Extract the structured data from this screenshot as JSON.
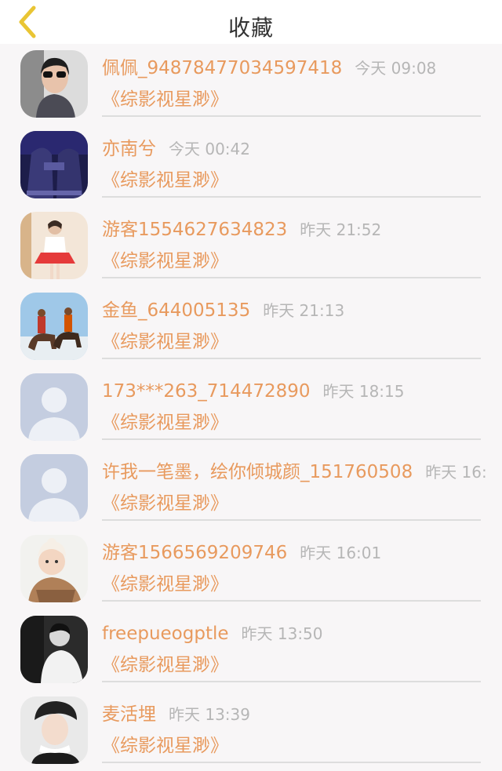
{
  "header": {
    "title": "收藏"
  },
  "items": [
    {
      "name": "佩佩_9487847703459741​8",
      "time": "今天 09:08",
      "subtitle": "《综影视星渺》",
      "avatar": "photo-woman-sunglasses-avatar"
    },
    {
      "name": "亦南兮",
      "time": "今天 00:42",
      "subtitle": "《综影视星渺》",
      "avatar": "photo-dark-outfit-avatar"
    },
    {
      "name": "游客1554627634823",
      "time": "昨天 21:52",
      "subtitle": "《综影视星渺》",
      "avatar": "photo-girl-red-skirt-avatar"
    },
    {
      "name": "金鱼_644005135",
      "time": "昨天 21:13",
      "subtitle": "《综影视星渺》",
      "avatar": "photo-horse-riders-avatar"
    },
    {
      "name": "173***263_714472890",
      "time": "昨天 18:15",
      "subtitle": "《综影视星渺》",
      "avatar": "default-user-avatar"
    },
    {
      "name": "许我一笔墨，绘你倾城颜_151760508",
      "time": "昨天 16:",
      "subtitle": "《综影视星渺》",
      "avatar": "default-user-avatar"
    },
    {
      "name": "游客1566569209746",
      "time": "昨天 16:01",
      "subtitle": "《综影视星渺》",
      "avatar": "photo-baby-avatar"
    },
    {
      "name": "freepueogptle",
      "time": "昨天 13:50",
      "subtitle": "《综影视星渺》",
      "avatar": "photo-bw-man-avatar"
    },
    {
      "name": "麦活埋",
      "time": "昨天 13:39",
      "subtitle": "《综影视星渺》",
      "avatar": "photo-woman-hat-avatar"
    }
  ],
  "colors": {
    "accent": "#e89a5e",
    "back_icon": "#e9c534",
    "time": "#b6b6b6"
  }
}
